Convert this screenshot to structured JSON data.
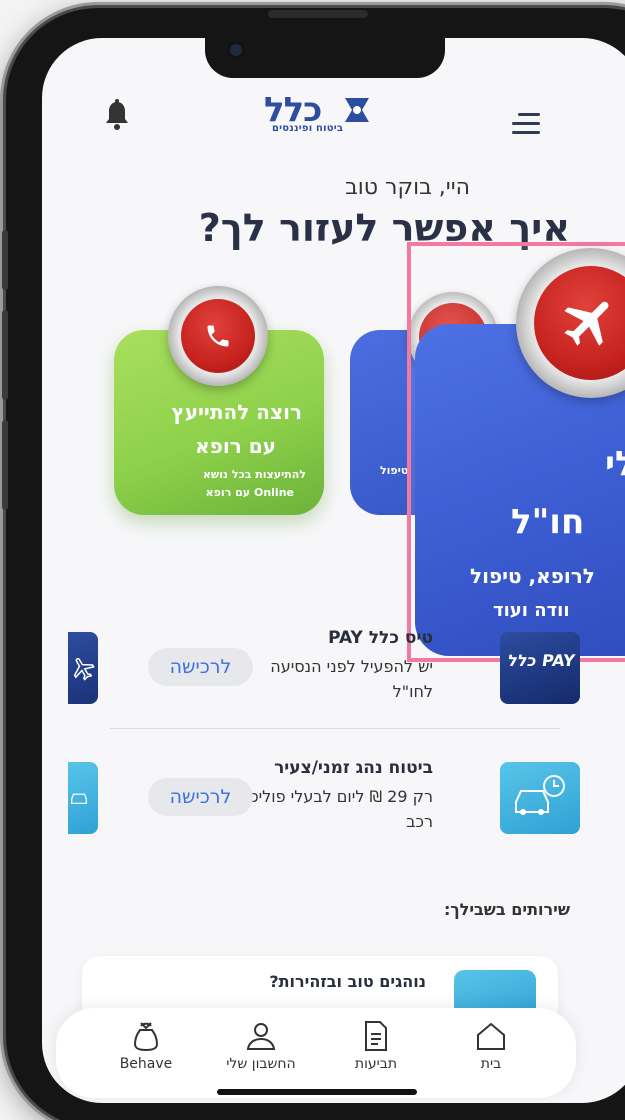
{
  "header": {
    "logo_brand": "כלל",
    "logo_subtitle": "ביטוח ופיננסים",
    "bell_icon": "bell-icon",
    "menu_icon": "hamburger-menu-icon"
  },
  "hero": {
    "greeting": "היי, בוקר טוב",
    "headline": "איך אפשר לעזור לך?"
  },
  "cards": {
    "doctor": {
      "title_line1": "רוצה להתייעץ",
      "title_line2": "עם רופא",
      "desc_line1": "להתיעצות בכל נושא",
      "desc_line2": "עם רופא Online",
      "icon": "phone-icon"
    },
    "travel_small": {
      "fragment": "טיפול",
      "icon": "airplane-icon"
    },
    "travel_zoom": {
      "line1": "לי",
      "line2": "חו\"ל",
      "line3": "לרופא, טיפול",
      "line4": "וודה ועוד",
      "icon": "airplane-icon"
    }
  },
  "offers": [
    {
      "title": "טיס כלל PAY",
      "desc": "יש להפעיל לפני הנסיעה לחו\"ל",
      "cta": "לרכישה",
      "thumb_label": "כלל PAY"
    },
    {
      "title": "ביטוח נהג זמני/צעיר",
      "desc": "רק 29 ₪ ליום לבעלי פוליסת רכב",
      "cta": "לרכישה",
      "thumb_icon": "car-clock-icon"
    }
  ],
  "services": {
    "title": "שירותים בשבילך:",
    "first_card_title": "נוהגים טוב ובזהירות?"
  },
  "tabbar": {
    "items": [
      {
        "label": "Behave",
        "icon": "behave-bag-icon"
      },
      {
        "label": "החשבון שלי",
        "icon": "user-icon"
      },
      {
        "label": "תביעות",
        "icon": "document-icon"
      },
      {
        "label": "בית",
        "icon": "home-icon"
      }
    ]
  },
  "colors": {
    "brand_blue": "#2d4da0",
    "accent_link": "#3d6fe0",
    "green_card": "#8ed14b",
    "blue_card": "#3a5ad0",
    "highlight_frame": "#f07aa0",
    "red_button": "#c7231f"
  }
}
